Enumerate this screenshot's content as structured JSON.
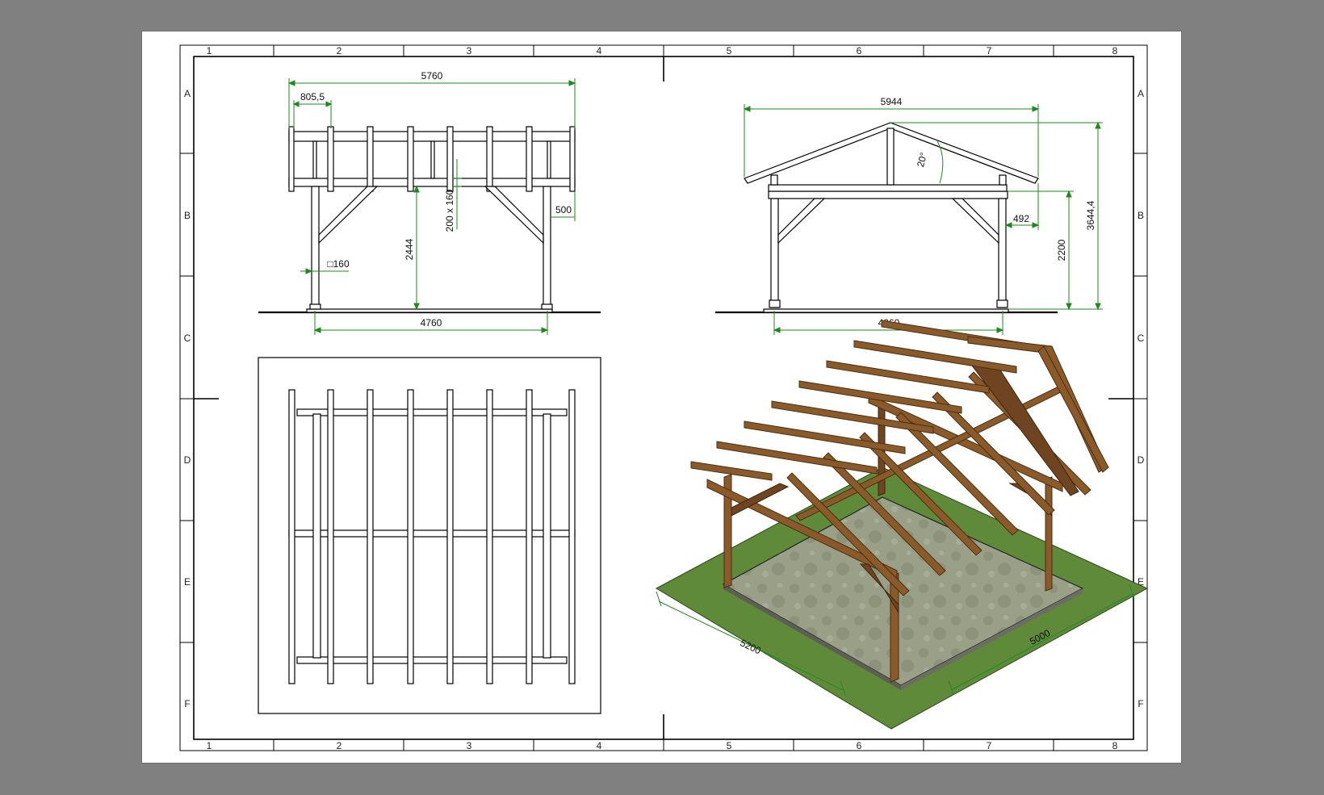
{
  "sheet": {
    "zones_top": [
      "1",
      "2",
      "3",
      "4",
      "5",
      "6",
      "7",
      "8"
    ],
    "zones_side": [
      "A",
      "B",
      "C",
      "D",
      "E",
      "F"
    ]
  },
  "front_view": {
    "overall_width": "5760",
    "overhang": "805,5",
    "beam_section": "200 x 160",
    "post_height": "2444",
    "brace_offset": "500",
    "post_section": "□160",
    "post_spacing": "4760"
  },
  "side_view": {
    "overall_width": "5944",
    "roof_pitch": "20°",
    "overhang": "492",
    "eave_height": "2200",
    "ridge_height": "3644,4",
    "post_spacing": "4960"
  },
  "iso_view": {
    "base_length": "5200",
    "base_width": "5000"
  },
  "colors": {
    "dimension": "#1f8a1f",
    "wood": "#8a5a2b",
    "grass": "#5f8a3a",
    "slab": "#9aa087",
    "background": "#808080"
  }
}
